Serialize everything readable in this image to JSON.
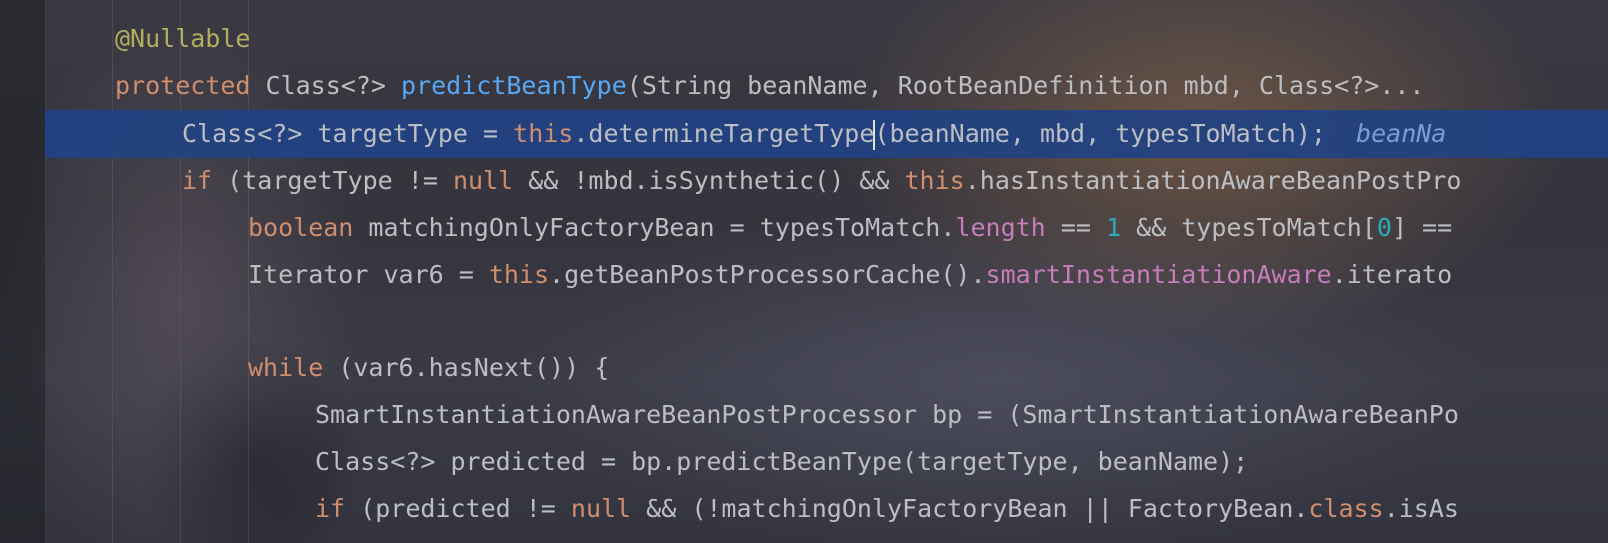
{
  "editor": {
    "lines": [
      [
        {
          "t": "@Nullable",
          "c": "ann"
        }
      ],
      [
        {
          "t": "protected",
          "c": "kw"
        },
        {
          "t": " Class<?> ",
          "c": ""
        },
        {
          "t": "predictBeanType",
          "c": "fn"
        },
        {
          "t": "(String beanName, RootBeanDefinition mbd, Class<?>... ",
          "c": ""
        }
      ],
      [
        {
          "t": "Class<?> targetType = ",
          "c": ""
        },
        {
          "t": "this",
          "c": "kw"
        },
        {
          "t": ".determineTargetType",
          "c": ""
        },
        {
          "t": "",
          "c": "caret"
        },
        {
          "t": "(beanName, mbd, typesToMatch);",
          "c": ""
        },
        {
          "t": "  ",
          "c": ""
        },
        {
          "t": "beanNa",
          "c": "hint"
        }
      ],
      [
        {
          "t": "if",
          "c": "kw"
        },
        {
          "t": " (targetType != ",
          "c": ""
        },
        {
          "t": "null",
          "c": "kw"
        },
        {
          "t": " && !mbd.isSynthetic() && ",
          "c": ""
        },
        {
          "t": "this",
          "c": "kw"
        },
        {
          "t": ".hasInstantiationAwareBeanPostPro",
          "c": ""
        }
      ],
      [
        {
          "t": "boolean",
          "c": "kw"
        },
        {
          "t": " matchingOnlyFactoryBean = typesToMatch.",
          "c": ""
        },
        {
          "t": "length",
          "c": "field"
        },
        {
          "t": " == ",
          "c": ""
        },
        {
          "t": "1",
          "c": "num"
        },
        {
          "t": " && typesToMatch[",
          "c": ""
        },
        {
          "t": "0",
          "c": "num"
        },
        {
          "t": "] ==",
          "c": ""
        }
      ],
      [
        {
          "t": "Iterator var6 = ",
          "c": ""
        },
        {
          "t": "this",
          "c": "kw"
        },
        {
          "t": ".getBeanPostProcessorCache().",
          "c": ""
        },
        {
          "t": "smartInstantiationAware",
          "c": "field"
        },
        {
          "t": ".iterato",
          "c": ""
        }
      ],
      [],
      [
        {
          "t": "while",
          "c": "kw"
        },
        {
          "t": " (var6.hasNext()) {",
          "c": ""
        }
      ],
      [
        {
          "t": "SmartInstantiationAwareBeanPostProcessor bp = (SmartInstantiationAwareBeanPo",
          "c": ""
        }
      ],
      [
        {
          "t": "Class<?> predicted = bp.predictBeanType(targetType, beanName);",
          "c": ""
        }
      ],
      [
        {
          "t": "if",
          "c": "kw"
        },
        {
          "t": " (predicted != ",
          "c": ""
        },
        {
          "t": "null",
          "c": "kw"
        },
        {
          "t": " && (!matchingOnlyFactoryBean || FactoryBean.",
          "c": ""
        },
        {
          "t": "class",
          "c": "kw"
        },
        {
          "t": ".isAs",
          "c": ""
        }
      ]
    ]
  }
}
